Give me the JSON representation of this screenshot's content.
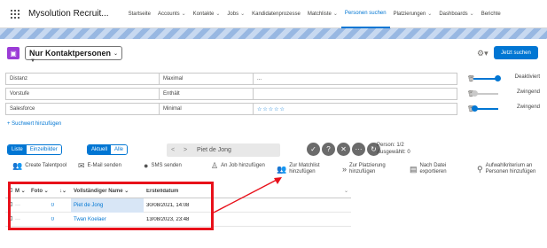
{
  "nav": {
    "app_name": "Mysolution Recruit...",
    "items": [
      {
        "label": "Startseite",
        "chevron": false,
        "active": false
      },
      {
        "label": "Accounts",
        "chevron": true,
        "active": false
      },
      {
        "label": "Kontakte",
        "chevron": true,
        "active": false
      },
      {
        "label": "Jobs",
        "chevron": true,
        "active": false
      },
      {
        "label": "Kandidatenprozesse",
        "chevron": false,
        "active": false
      },
      {
        "label": "Matchliste",
        "chevron": true,
        "active": false
      },
      {
        "label": "Personen suchen",
        "chevron": false,
        "active": true
      },
      {
        "label": "Platzierungen",
        "chevron": true,
        "active": false
      },
      {
        "label": "Dashboards",
        "chevron": true,
        "active": false
      },
      {
        "label": "Berichte",
        "chevron": false,
        "active": false
      }
    ]
  },
  "header": {
    "view_select": "Nur Kontaktpersonen",
    "search_button": "Jetzt suchen"
  },
  "filters": [
    {
      "field": "Distanz",
      "operator": "Maximal",
      "value": "...",
      "stars": false,
      "weight": "Deaktiviert"
    },
    {
      "field": "Vorstufe",
      "operator": "Enthält",
      "value": "",
      "stars": false,
      "weight": "Zwingend"
    },
    {
      "field": "Salesforce",
      "operator": "Minimal",
      "value": "",
      "stars": true,
      "weight": "Zwingend"
    }
  ],
  "add_filter": "+ Suchwert hinzufügen",
  "toolbar": {
    "view_tabs": [
      "Liste",
      "Einzelbilder"
    ],
    "scope_tabs": [
      "Aktuell",
      "Alle"
    ],
    "current_name": "Piet de Jong",
    "person_label": "Person: 1/2",
    "selected_label": "Ausgewählt: 0"
  },
  "actions": [
    {
      "icon": "people-icon",
      "label": "Create Talentpool"
    },
    {
      "icon": "email-icon",
      "label": "E-Mail senden"
    },
    {
      "icon": "sms-icon",
      "label": "SMS senden"
    },
    {
      "icon": "job-icon",
      "label": "An Job hinzufügen"
    },
    {
      "icon": "matchlist-icon",
      "label": "Zur Matchlist hinzufügen"
    },
    {
      "icon": "placement-icon",
      "label": "Zur Platzierung hinzufügen"
    },
    {
      "icon": "file-icon",
      "label": "Nach Datei exportieren"
    },
    {
      "icon": "criteria-icon",
      "label": "Aufwahlkriterium an Personen hinzufügen"
    }
  ],
  "table": {
    "headers": [
      "M",
      "Foto",
      "↓",
      "Vollständiger Name",
      "Erstelldatum"
    ],
    "rows": [
      {
        "m": "···",
        "foto": "0",
        "name": "Piet de Jong",
        "date": "30/08/2021, 14:08"
      },
      {
        "m": "···",
        "foto": "0",
        "name": "Twan Koelaer",
        "date": "13/08/2023, 23:48"
      }
    ]
  },
  "colors": {
    "accent": "#0176d3",
    "highlight": "#e8101a",
    "object_icon": "#9b3cd6"
  }
}
